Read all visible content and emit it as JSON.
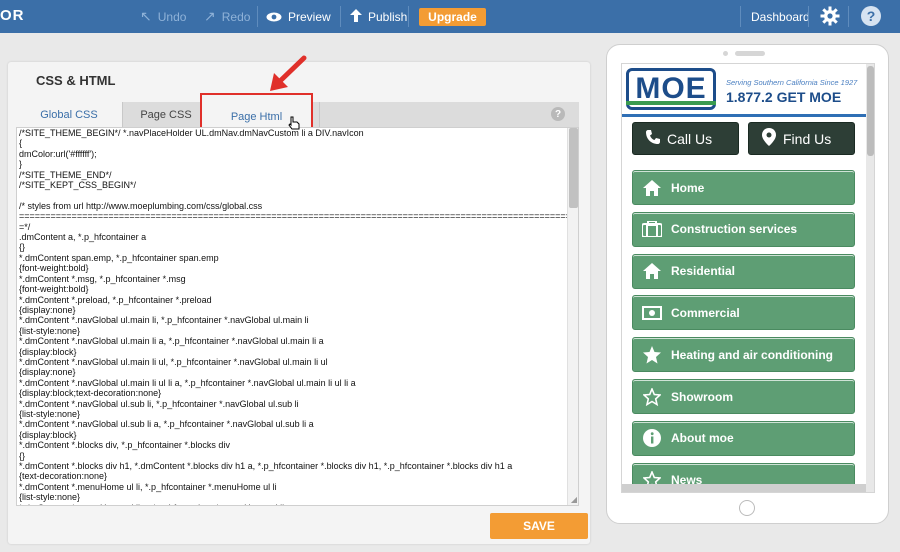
{
  "topbar": {
    "logo": "OR",
    "undo": "Undo",
    "redo": "Redo",
    "preview": "Preview",
    "publish": "Publish",
    "upgrade": "Upgrade",
    "dashboard": "Dashboard",
    "help": "?"
  },
  "panel": {
    "title": "CSS & HTML",
    "tabs": [
      "Global CSS",
      "Page CSS",
      "Page Html"
    ],
    "help": "?",
    "save": "SAVE",
    "code_lines": [
      "/*SITE_THEME_BEGIN*/ *.navPlaceHolder UL.dmNav.dmNavCustom li a DIV.navIcon",
      "{",
      "        dmColor:url('#ffffff');",
      "}",
      "/*SITE_THEME_END*/",
      "/*SITE_KEPT_CSS_BEGIN*/",
      "",
      "/* styles from url http://www.moeplumbing.com/css/global.css",
      "========================================================================================================================",
      "=*/",
      ".dmContent a, *.p_hfcontainer a",
      "{}",
      "*.dmContent span.emp, *.p_hfcontainer span.emp",
      "{font-weight:bold}",
      "*.dmContent *.msg, *.p_hfcontainer *.msg",
      "{font-weight:bold}",
      "*.dmContent *.preload, *.p_hfcontainer *.preload",
      "{display:none}",
      "*.dmContent *.navGlobal ul.main li, *.p_hfcontainer *.navGlobal ul.main li",
      "{list-style:none}",
      "*.dmContent *.navGlobal ul.main li a, *.p_hfcontainer *.navGlobal ul.main li a",
      "{display:block}",
      "*.dmContent *.navGlobal ul.main li ul, *.p_hfcontainer *.navGlobal ul.main li ul",
      "{display:none}",
      "*.dmContent *.navGlobal ul.main li ul li a, *.p_hfcontainer *.navGlobal ul.main li ul li a",
      "{display:block;text-decoration:none}",
      "*.dmContent *.navGlobal ul.sub li, *.p_hfcontainer *.navGlobal ul.sub li",
      "{list-style:none}",
      "*.dmContent *.navGlobal ul.sub li a, *.p_hfcontainer *.navGlobal ul.sub li a",
      "{display:block}",
      "*.dmContent *.blocks div, *.p_hfcontainer *.blocks div",
      "{}",
      "*.dmContent *.blocks div h1, *.dmContent *.blocks div h1 a, *.p_hfcontainer *.blocks div h1, *.p_hfcontainer *.blocks div h1 a",
      "{text-decoration:none}",
      "*.dmContent *.menuHome ul li, *.p_hfcontainer *.menuHome ul li",
      "{list-style:none}",
      "*.dmContent *.menuHome ul li a, *.p_hfcontainer *.menuHome ul li a"
    ]
  },
  "preview": {
    "logo": "MOE",
    "tagline": "Serving Southern California Since 1927",
    "phone": "1.877.2 GET MOE",
    "call_us": "Call Us",
    "find_us": "Find Us",
    "nav": [
      {
        "label": "Home",
        "icon": "home-icon"
      },
      {
        "label": "Construction services",
        "icon": "briefcase-icon"
      },
      {
        "label": "Residential",
        "icon": "home-icon"
      },
      {
        "label": "Commercial",
        "icon": "money-icon"
      },
      {
        "label": "Heating and air conditioning",
        "icon": "star-icon"
      },
      {
        "label": "Showroom",
        "icon": "star-outline-icon"
      },
      {
        "label": "About moe",
        "icon": "info-icon"
      },
      {
        "label": "News",
        "icon": "star-outline-icon"
      }
    ]
  },
  "colors": {
    "topbar": "#3b6fa8",
    "accent": "#f39c34",
    "nav_green": "#5e9e74",
    "highlight": "#e0302a"
  }
}
